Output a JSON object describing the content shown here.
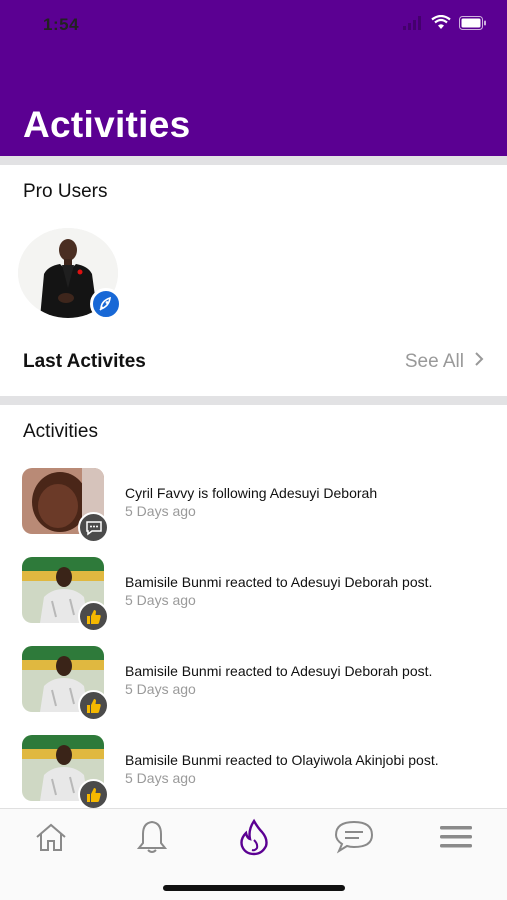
{
  "status_bar": {
    "time": "1:54"
  },
  "header": {
    "title": "Activities"
  },
  "pro_users": {
    "title": "Pro Users"
  },
  "last_activities": {
    "title": "Last Activites",
    "see_all": "See All"
  },
  "activities": {
    "title": "Activities",
    "items": [
      {
        "text": "Cyril Favvy is following Adesuyi Deborah",
        "time": "5 Days ago",
        "badge_icon": "chat-bubble-icon"
      },
      {
        "text": "Bamisile Bunmi reacted to Adesuyi Deborah post.",
        "time": "5 Days ago",
        "badge_icon": "thumbs-up-icon"
      },
      {
        "text": "Bamisile Bunmi reacted to Adesuyi Deborah post.",
        "time": "5 Days ago",
        "badge_icon": "thumbs-up-icon"
      },
      {
        "text": "Bamisile Bunmi reacted to Olayiwola Akinjobi post.",
        "time": "5 Days ago",
        "badge_icon": "thumbs-up-icon"
      }
    ]
  },
  "tabbar": {
    "tabs": [
      "home-icon",
      "bell-icon",
      "flame-icon",
      "chat-icon",
      "menu-icon"
    ],
    "active": "flame-icon"
  },
  "colors": {
    "header": "#5b0092",
    "active_tab": "#5b0092",
    "badge_blue": "#1868d6"
  }
}
